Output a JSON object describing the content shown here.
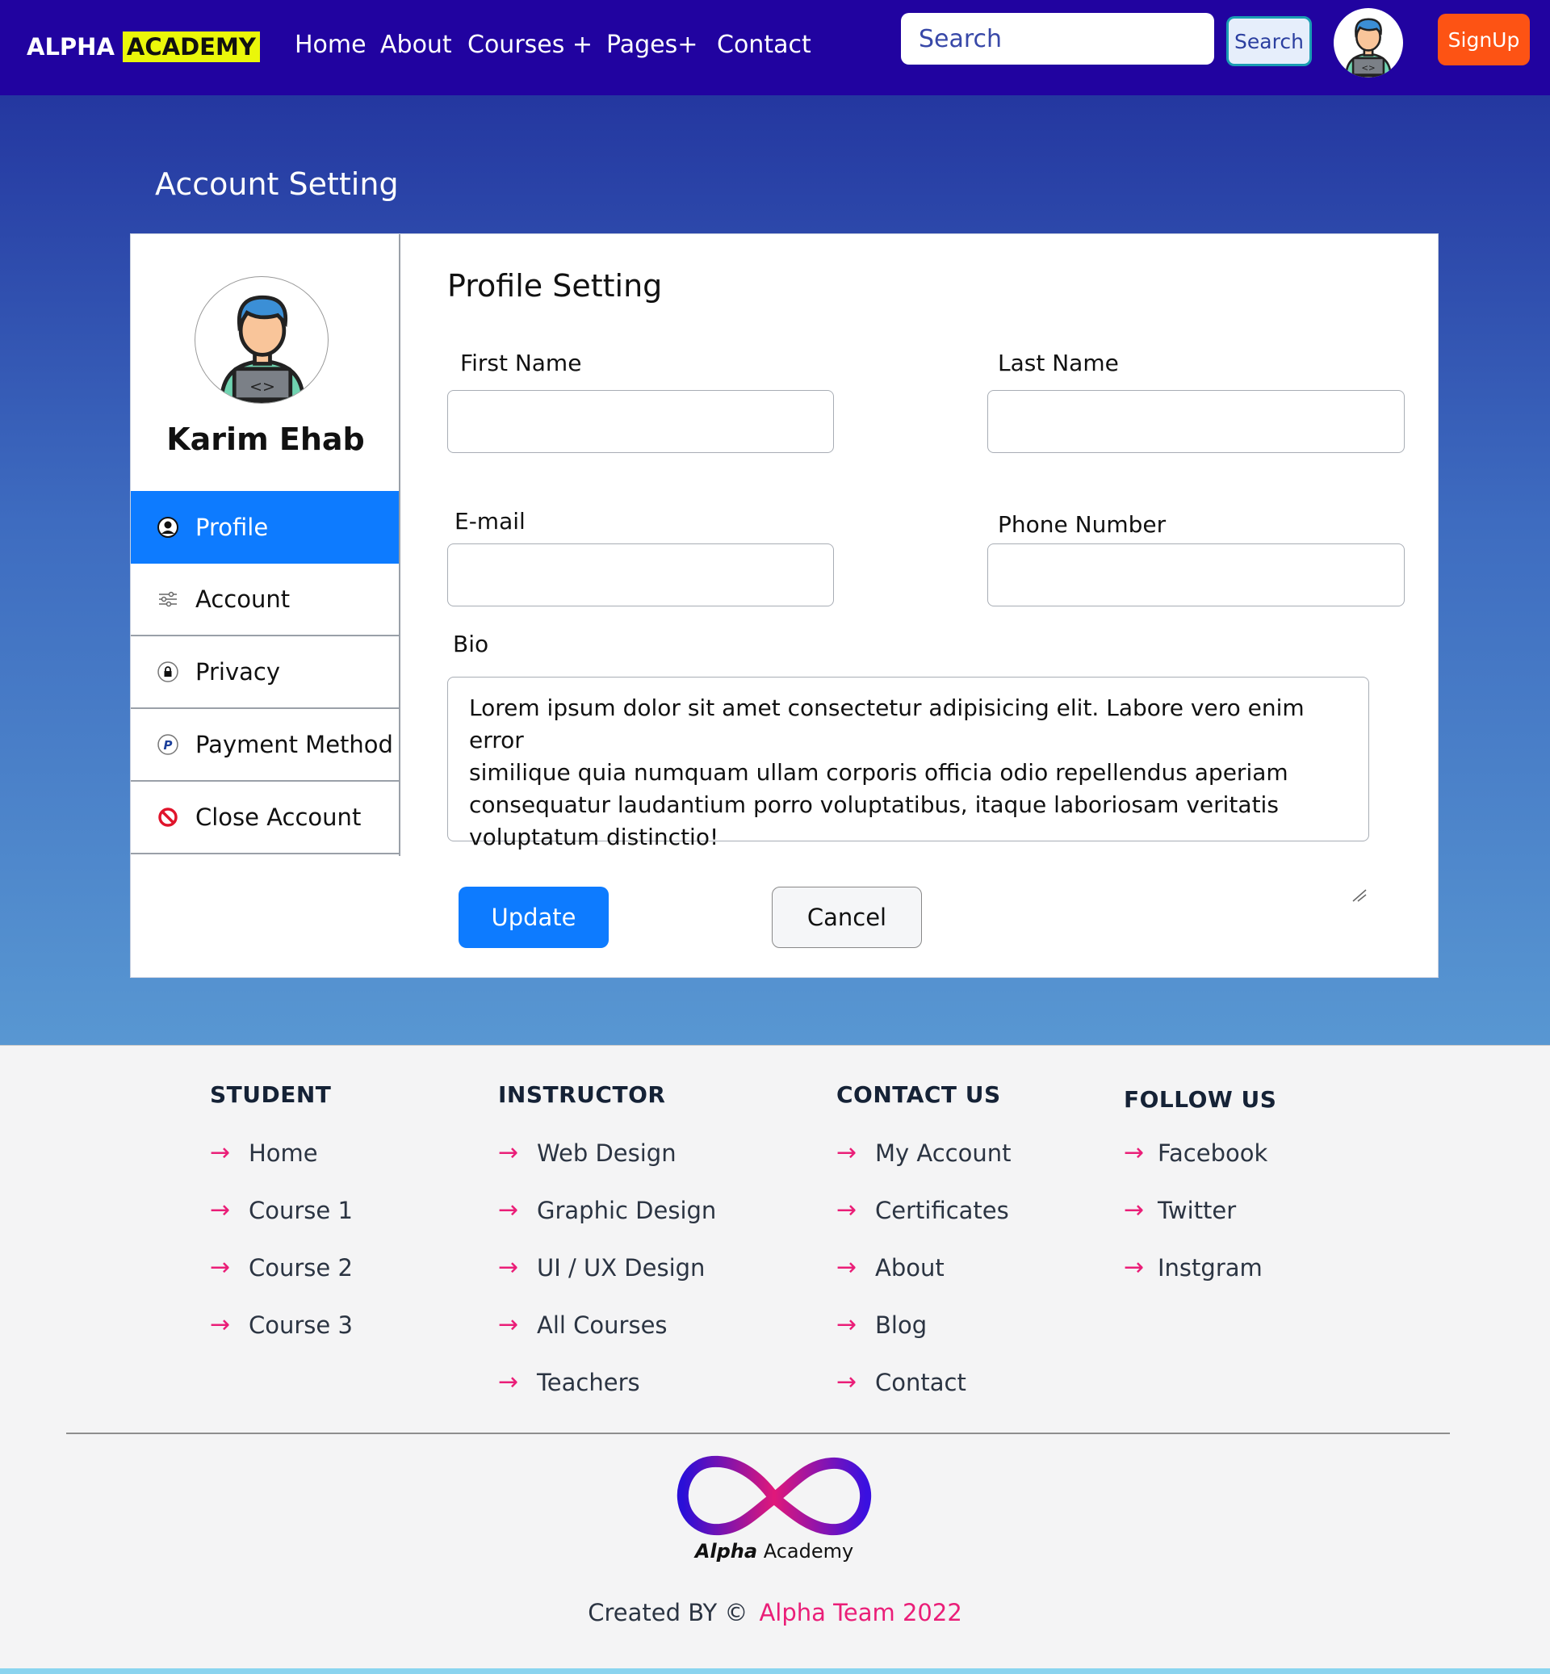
{
  "navbar": {
    "brand_part1": "ALPHA",
    "brand_part2": "ACADEMY",
    "links": [
      "Home",
      "About",
      "Courses +",
      "Pages+",
      "Contact"
    ],
    "search_placeholder": "Search",
    "search_button": "Search",
    "signup_button": "SignUp"
  },
  "page": {
    "title": "Account Setting"
  },
  "sidebar": {
    "user_name": "Karim Ehab",
    "items": [
      {
        "label": "Profile",
        "icon": "user-circle-icon",
        "active": true
      },
      {
        "label": "Account",
        "icon": "sliders-icon",
        "active": false
      },
      {
        "label": "Privacy",
        "icon": "lock-icon",
        "active": false
      },
      {
        "label": "Payment Method",
        "icon": "paypal-icon",
        "active": false
      },
      {
        "label": "Close Account",
        "icon": "prohibited-icon",
        "active": false
      }
    ]
  },
  "form": {
    "title": "Profile Setting",
    "first_name_label": "First Name",
    "last_name_label": "Last Name",
    "email_label": "E-mail",
    "phone_label": "Phone Number",
    "bio_label": "Bio",
    "bio_value": "Lorem ipsum dolor sit amet consectetur adipisicing elit. Labore vero enim error\nsimilique quia numquam ullam corporis officia odio repellendus aperiam\n consequatur laudantium porro voluptatibus, itaque laboriosam veritatis\n voluptatum distinctio!",
    "update_button": "Update",
    "cancel_button": "Cancel"
  },
  "footer": {
    "columns": [
      {
        "heading": "STUDENT",
        "links": [
          "Home",
          "Course 1",
          "Course 2",
          "Course 3"
        ]
      },
      {
        "heading": "INSTRUCTOR",
        "links": [
          "Web Design",
          "Graphic Design",
          "UI / UX Design",
          "All Courses",
          "Teachers"
        ]
      },
      {
        "heading": "CONTACT US",
        "links": [
          "My Account",
          "Certificates",
          "About",
          "Blog",
          "Contact"
        ]
      },
      {
        "heading": "FOLLOW US",
        "links": [
          "Facebook",
          "Twitter",
          "Instgram"
        ]
      }
    ],
    "logo_text_bold": "Alpha",
    "logo_text_rest": " Academy",
    "credits_prefix": "Created BY ©",
    "credits_team": "Alpha Team 2022"
  },
  "colors": {
    "navbar_bg": "#2103a0",
    "brand_highlight": "#eaf70a",
    "signup_bg": "#fd5314",
    "primary_blue": "#0d7bff",
    "footer_accent": "#ea1e78"
  }
}
